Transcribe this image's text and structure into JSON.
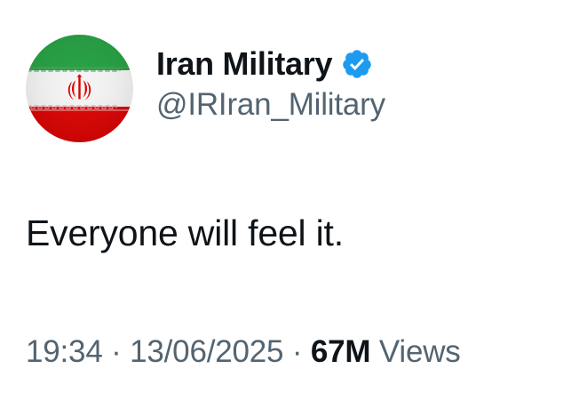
{
  "user": {
    "display_name": "Iran Military",
    "handle": "@IRIran_Military",
    "verified": true,
    "avatar_icon": "iran-flag-icon",
    "verified_icon": "verified-badge-icon",
    "verified_color": "#1d9bf0"
  },
  "tweet": {
    "text": "Everyone will feel it."
  },
  "meta": {
    "time": "19:34",
    "separator": "·",
    "date": "13/06/2025",
    "views_count": "67M",
    "views_label": "Views"
  },
  "colors": {
    "text_primary": "#0f1419",
    "text_secondary": "#536471",
    "flag_green": "#239f40",
    "flag_white": "#ffffff",
    "flag_red": "#da0000"
  }
}
